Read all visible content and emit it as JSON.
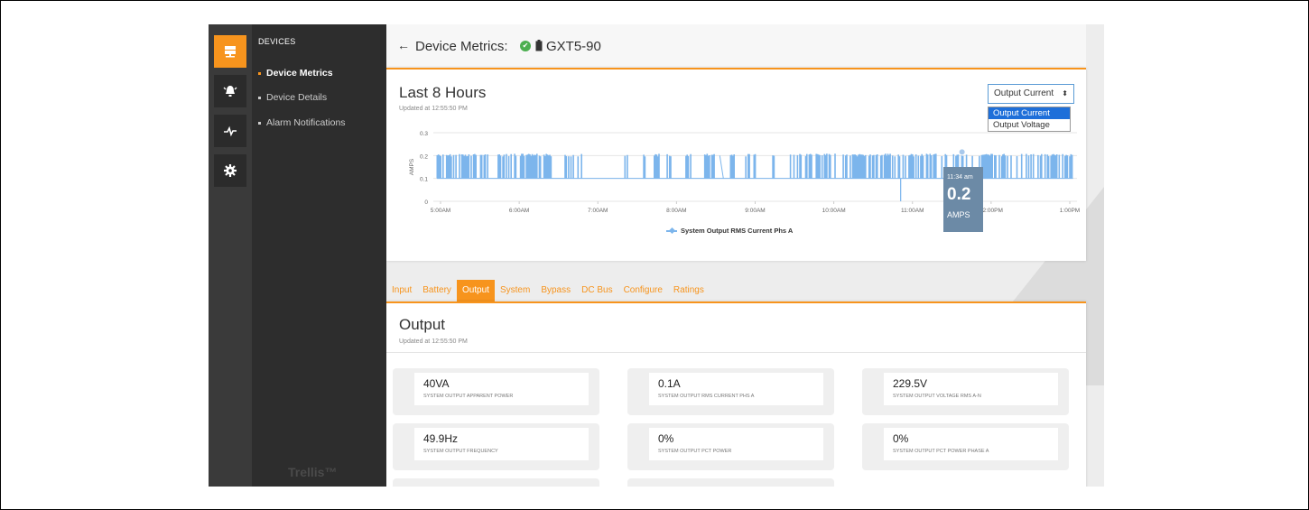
{
  "rail": {
    "icons": [
      "server-icon",
      "alarm-bell-icon",
      "pulse-icon",
      "gear-icon"
    ]
  },
  "nav": {
    "header": "DEVICES",
    "items": [
      {
        "label": "Device Metrics",
        "active": true
      },
      {
        "label": "Device Details",
        "active": false
      },
      {
        "label": "Alarm Notifications",
        "active": false
      }
    ],
    "brand": "Trellis™"
  },
  "page": {
    "title": "Device Metrics:",
    "device": "GXT5-90"
  },
  "chart_card": {
    "title": "Last 8 Hours",
    "updated": "Updated at 12:55:50 PM",
    "select_value": "Output Current",
    "select_options": [
      "Output Current",
      "Output Voltage"
    ]
  },
  "chart_data": {
    "type": "line",
    "title": "",
    "ylabel": "AMPS",
    "ylim": [
      0,
      0.3
    ],
    "yticks": [
      "0",
      "0.1",
      "0.2",
      "0.3"
    ],
    "xticks": [
      "5:00AM",
      "6:00AM",
      "7:00AM",
      "8:00AM",
      "9:00AM",
      "10:00AM",
      "11:00AM",
      "12:00PM",
      "1:00PM"
    ],
    "series": [
      {
        "name": "System Output RMS Current Phs A",
        "baseline": 0.1,
        "high": 0.2,
        "min_value": 0.0
      }
    ],
    "tooltip": {
      "time": "11:34 am",
      "value": "0.2",
      "unit": "AMPS"
    },
    "color": "#7cb5ec"
  },
  "tabs": [
    {
      "label": "Input",
      "active": false
    },
    {
      "label": "Battery",
      "active": false
    },
    {
      "label": "Output",
      "active": true
    },
    {
      "label": "System",
      "active": false
    },
    {
      "label": "Bypass",
      "active": false
    },
    {
      "label": "DC Bus",
      "active": false
    },
    {
      "label": "Configure",
      "active": false
    },
    {
      "label": "Ratings",
      "active": false
    }
  ],
  "output": {
    "title": "Output",
    "updated": "Updated at 12:55:50 PM",
    "metrics": [
      {
        "value": "40VA",
        "label": "SYSTEM OUTPUT APPARENT POWER"
      },
      {
        "value": "0.1A",
        "label": "SYSTEM OUTPUT RMS CURRENT PHS A"
      },
      {
        "value": "229.5V",
        "label": "SYSTEM OUTPUT VOLTAGE RMS A-N"
      },
      {
        "value": "49.9Hz",
        "label": "SYSTEM OUTPUT FREQUENCY"
      },
      {
        "value": "0%",
        "label": "SYSTEM OUTPUT PCT POWER"
      },
      {
        "value": "0%",
        "label": "SYSTEM OUTPUT PCT POWER PHASE A"
      }
    ]
  },
  "colors": {
    "accent": "#f7941d",
    "rail": "#3a3a3a",
    "nav": "#2d2d2d",
    "series": "#7cb5ec",
    "link": "#1e6fd9"
  }
}
